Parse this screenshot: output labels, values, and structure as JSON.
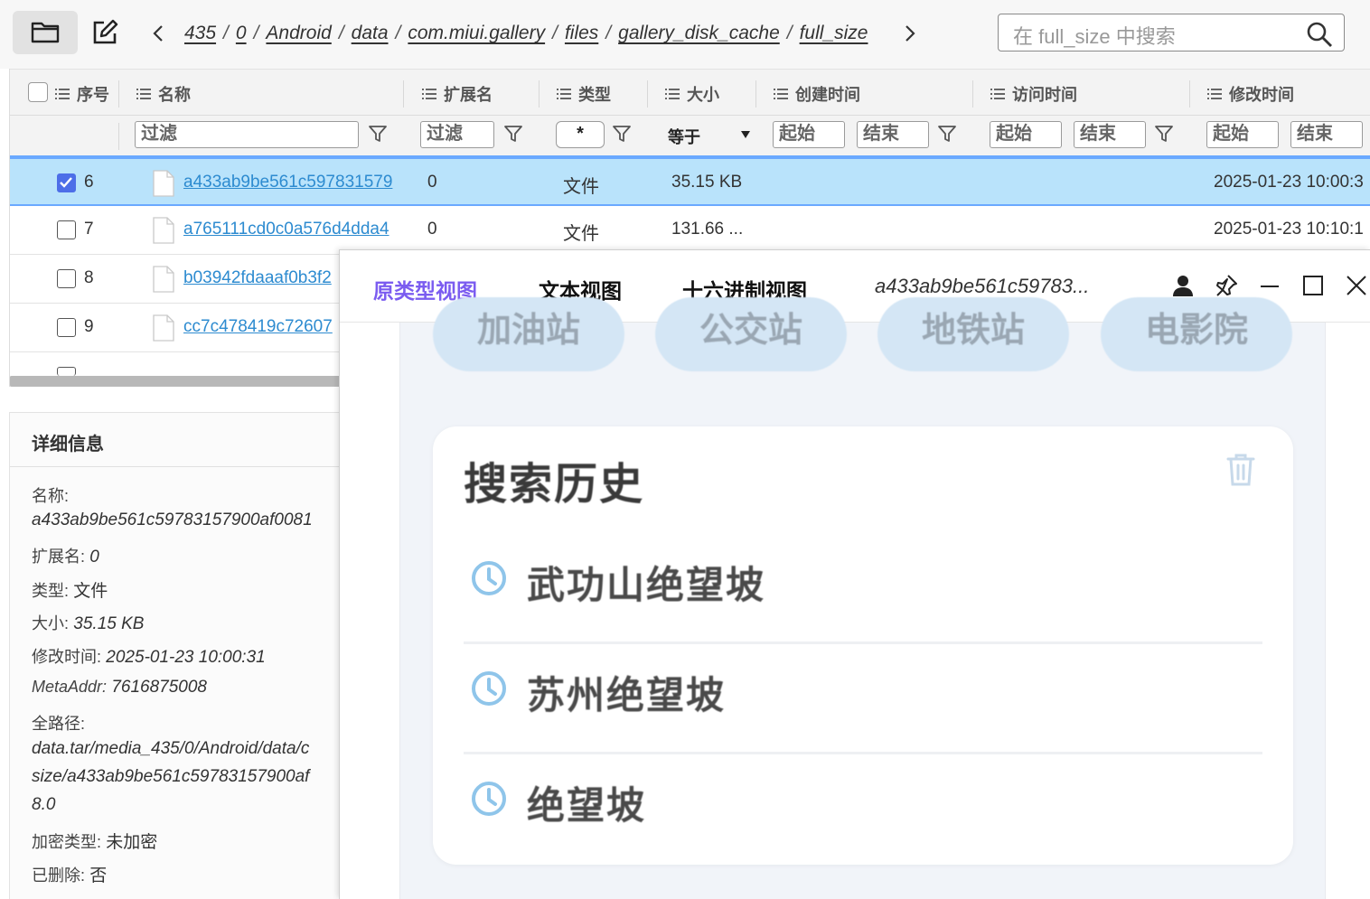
{
  "toolbar": {
    "breadcrumb": [
      "435",
      "0",
      "Android",
      "data",
      "com.miui.gallery",
      "files",
      "gallery_disk_cache",
      "full_size"
    ],
    "search_placeholder": "在 full_size 中搜索"
  },
  "table": {
    "columns": [
      "序号",
      "名称",
      "扩展名",
      "类型",
      "大小",
      "创建时间",
      "访问时间",
      "修改时间"
    ],
    "filters": {
      "name": "过滤",
      "ext": "过滤",
      "type": "*",
      "size_op": "等于",
      "created_start": "起始",
      "created_end": "结束",
      "accessed_start": "起始",
      "accessed_end": "结束",
      "modified_start": "起始",
      "modified_end": "结束"
    },
    "rows": [
      {
        "num": "6",
        "name": "a433ab9be561c597831579",
        "ext": "0",
        "type": "文件",
        "size": "35.15 KB",
        "modified": "2025-01-23 10:00:3",
        "selected": true
      },
      {
        "num": "7",
        "name": "a765111cd0c0a576d4dda4",
        "ext": "0",
        "type": "文件",
        "size": "131.66 ...",
        "modified": "2025-01-23 10:10:1",
        "selected": false
      },
      {
        "num": "8",
        "name": "b03942fdaaaf0b3f2",
        "ext": "",
        "type": "",
        "size": "",
        "modified": "",
        "selected": false
      },
      {
        "num": "9",
        "name": "cc7c478419c72607",
        "ext": "",
        "type": "",
        "size": "",
        "modified": "",
        "selected": false
      }
    ]
  },
  "details": {
    "title": "详细信息",
    "name_label": "名称:",
    "name_value": "a433ab9be561c59783157900af0081",
    "ext_label": "扩展名:",
    "ext_value": "0",
    "type_label": "类型:",
    "type_value": "文件",
    "size_label": "大小:",
    "size_value": "35.15 KB",
    "mtime_label": "修改时间:",
    "mtime_value": "2025-01-23 10:00:31",
    "meta_label": "MetaAddr:",
    "meta_value": "7616875008",
    "path_label": "全路径:",
    "path_line1": "data.tar/media_435/0/Android/data/c",
    "path_line2": "size/a433ab9be561c59783157900af",
    "path_line3": "8.0",
    "enc_label": "加密类型:",
    "enc_value": "未加密",
    "del_label": "已删除:",
    "del_value": "否"
  },
  "viewer": {
    "tabs": [
      "原类型视图",
      "文本视图",
      "十六进制视图"
    ],
    "active_tab": 0,
    "file_title": "a433ab9be561c59783...",
    "image": {
      "chips": [
        "加油站",
        "公交站",
        "地铁站",
        "电影院"
      ],
      "history_title": "搜索历史",
      "history_items": [
        "武功山绝望坡",
        "苏州绝望坡",
        "绝望坡"
      ]
    }
  },
  "colors": {
    "accent": "#7b5cf0",
    "link": "#2d8bd0",
    "selected_row": "#b9e3fb",
    "checkbox_on": "#4d6ee8"
  }
}
